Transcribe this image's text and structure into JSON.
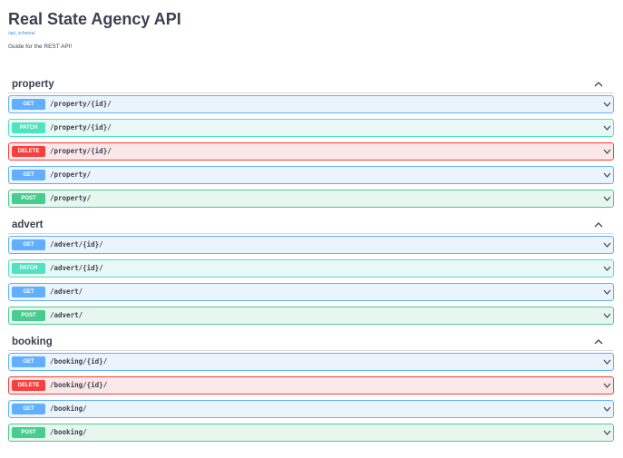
{
  "info": {
    "title": "Real State Agency API",
    "schema_link": "/api_schema/",
    "description": "Guide for the REST API!"
  },
  "icons": {
    "collapse": "chevron-up-icon",
    "expand": "chevron-down-icon"
  },
  "colors": {
    "get": "#61affe",
    "patch": "#50e3c2",
    "delete": "#f93e3e",
    "post": "#49cc90"
  },
  "tags": [
    {
      "name": "property",
      "operations": [
        {
          "method": "GET",
          "path": "/property/{id}/"
        },
        {
          "method": "PATCH",
          "path": "/property/{id}/"
        },
        {
          "method": "DELETE",
          "path": "/property/{id}/"
        },
        {
          "method": "GET",
          "path": "/property/"
        },
        {
          "method": "POST",
          "path": "/property/"
        }
      ]
    },
    {
      "name": "advert",
      "operations": [
        {
          "method": "GET",
          "path": "/advert/{id}/"
        },
        {
          "method": "PATCH",
          "path": "/advert/{id}/"
        },
        {
          "method": "GET",
          "path": "/advert/"
        },
        {
          "method": "POST",
          "path": "/advert/"
        }
      ]
    },
    {
      "name": "booking",
      "operations": [
        {
          "method": "GET",
          "path": "/booking/{id}/"
        },
        {
          "method": "DELETE",
          "path": "/booking/{id}/"
        },
        {
          "method": "GET",
          "path": "/booking/"
        },
        {
          "method": "POST",
          "path": "/booking/"
        }
      ]
    }
  ]
}
